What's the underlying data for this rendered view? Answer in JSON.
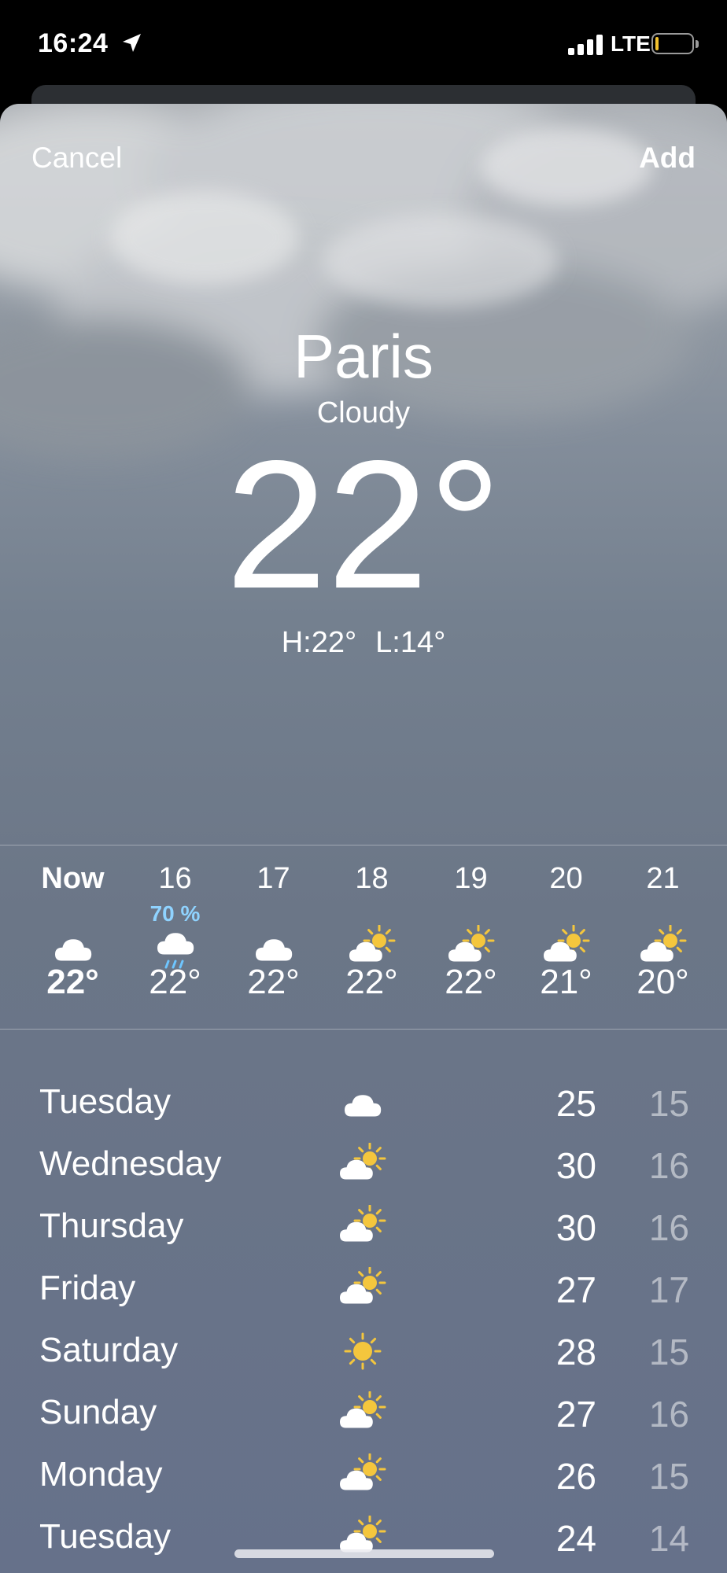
{
  "status_bar": {
    "time": "16:24",
    "network": "LTE",
    "battery_fraction": 0.08
  },
  "nav": {
    "cancel_label": "Cancel",
    "add_label": "Add"
  },
  "current": {
    "city": "Paris",
    "condition": "Cloudy",
    "temperature": "22°",
    "high": "H:22°",
    "low": "L:14°"
  },
  "hourly": [
    {
      "label": "Now",
      "icon": "cloud-icon",
      "temp": "22°",
      "precip": ""
    },
    {
      "label": "16",
      "icon": "cloud-rain-icon",
      "temp": "22°",
      "precip": "70 %"
    },
    {
      "label": "17",
      "icon": "cloud-icon",
      "temp": "22°",
      "precip": ""
    },
    {
      "label": "18",
      "icon": "partly-sunny-icon",
      "temp": "22°",
      "precip": ""
    },
    {
      "label": "19",
      "icon": "partly-sunny-icon",
      "temp": "22°",
      "precip": ""
    },
    {
      "label": "20",
      "icon": "partly-sunny-icon",
      "temp": "21°",
      "precip": ""
    },
    {
      "label": "21",
      "icon": "partly-sunny-icon",
      "temp": "20°",
      "precip": ""
    }
  ],
  "daily": [
    {
      "day": "Tuesday",
      "icon": "cloud-icon",
      "high": "25",
      "low": "15"
    },
    {
      "day": "Wednesday",
      "icon": "partly-sunny-icon",
      "high": "30",
      "low": "16"
    },
    {
      "day": "Thursday",
      "icon": "partly-sunny-icon",
      "high": "30",
      "low": "16"
    },
    {
      "day": "Friday",
      "icon": "partly-sunny-icon",
      "high": "27",
      "low": "17"
    },
    {
      "day": "Saturday",
      "icon": "sun-icon",
      "high": "28",
      "low": "15"
    },
    {
      "day": "Sunday",
      "icon": "partly-sunny-icon",
      "high": "27",
      "low": "16"
    },
    {
      "day": "Monday",
      "icon": "partly-sunny-icon",
      "high": "26",
      "low": "15"
    },
    {
      "day": "Tuesday",
      "icon": "partly-sunny-icon",
      "high": "24",
      "low": "14"
    }
  ],
  "colors": {
    "sun": "#f4c63d",
    "precip_text": "#8fd3ff",
    "rain_drop": "#6ec6ff"
  }
}
